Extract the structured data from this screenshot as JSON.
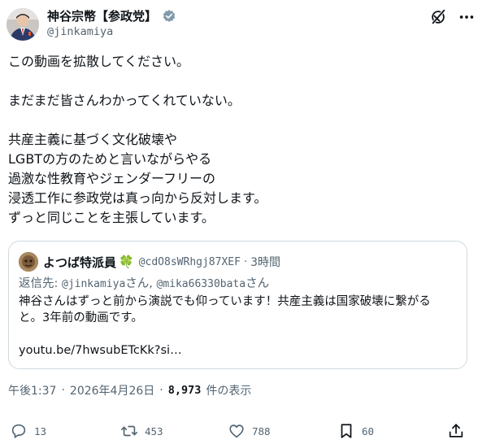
{
  "author": {
    "display_name": "神谷宗幣【参政党】",
    "handle": "@jinkamiya",
    "verified": true,
    "verified_color": "#829aab"
  },
  "post": {
    "lines": [
      "この動画を拡散してください。",
      "",
      "まだまだ皆さんわかってくれていない。",
      "",
      "共産主義に基づく文化破壊や",
      "LGBTの方のためと言いながらやる",
      "過激な性教育やジェンダーフリーの",
      "浸透工作に参政党は真っ向から反対します。",
      "ずっと同じことを主張しています。"
    ]
  },
  "quote": {
    "display_name": "よつば特派員",
    "emoji": "🍀",
    "handle": "@cdO8sWRhgj87XEF",
    "separator": "·",
    "time": "3時間",
    "reply_prefix": "返信先: ",
    "reply_handle_1": "@jinkamiya",
    "reply_mid": "さん, ",
    "reply_handle_2": "@mika66330bata",
    "reply_suffix": "さん",
    "lines": [
      "神谷さんはずっと前から演説でも仰っています！共産主義は国家破壊に繋がる",
      "と。3年前の動画です。",
      "",
      "youtu.be/7hwsubETcKk?si…"
    ]
  },
  "meta": {
    "time": "午後1:37",
    "date": "2026年4月26日",
    "separator": "·",
    "views_count": "8,973",
    "views_label": "件の表示"
  },
  "actions": {
    "replies": "13",
    "reposts": "453",
    "likes": "788",
    "bookmarks": "60"
  },
  "icons": {
    "grok": "grok-icon",
    "more": "more-icon",
    "reply": "reply-icon",
    "repost": "repost-icon",
    "like": "heart-icon",
    "bookmark": "bookmark-icon",
    "share": "share-icon"
  },
  "colors": {
    "text": "#0f1419",
    "secondary": "#536471",
    "border": "#cfd9de",
    "clover": "#2e9a37"
  }
}
